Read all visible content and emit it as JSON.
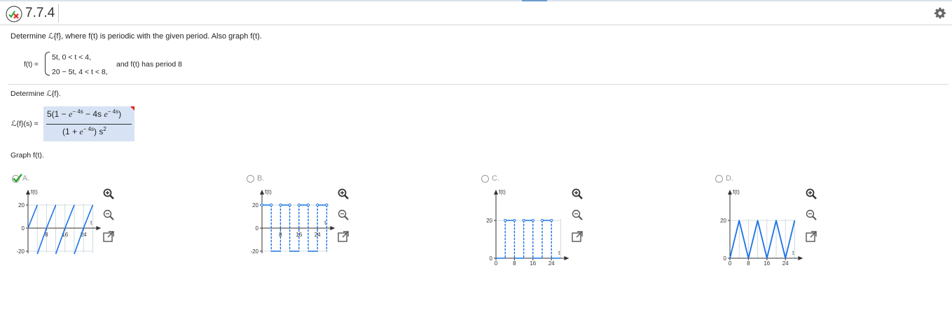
{
  "header": {
    "question_number": "7.7.4",
    "status_icon": "partial-credit-icon",
    "settings_icon": "gear-icon"
  },
  "problem": {
    "prompt": "Determine ℒ{f}, where f(t) is periodic with the given period. Also graph f(t).",
    "f_label": "f(t) =",
    "case1": "5t, 0 < t < 4,",
    "case2": "20 − 5t, 4 < t < 8,",
    "period_text": "and f(t) has period 8"
  },
  "part1": {
    "instruction": "Determine ℒ{f}.",
    "lhs": "ℒ{f}(s) =",
    "answer_numerator": {
      "a": "5(1 − ",
      "b": "e",
      "c": "− 4s",
      "d": " − 4s ",
      "e": "e",
      "f": "− 4s",
      "g": ")"
    },
    "answer_denominator": {
      "a": "(1 + ",
      "b": "e",
      "c": "− 4s",
      "d": ") s",
      "e": "2"
    },
    "answer_state": "incorrect-marked"
  },
  "part2": {
    "instruction": "Graph f(t).",
    "options": [
      {
        "letter": "A.",
        "selected": true,
        "y_ticks": [
          "20",
          "0",
          "-20"
        ],
        "x_ticks": [
          "8",
          "16",
          "24"
        ],
        "ylabel": "f(t)",
        "xlabel": "t"
      },
      {
        "letter": "B.",
        "selected": false,
        "y_ticks": [
          "20",
          "0",
          "-20"
        ],
        "x_ticks": [
          "8",
          "16",
          "24"
        ],
        "ylabel": "f(t)",
        "xlabel": "t"
      },
      {
        "letter": "C.",
        "selected": false,
        "y_ticks": [
          "20",
          "0"
        ],
        "x_ticks": [
          "0",
          "8",
          "16",
          "24"
        ],
        "ylabel": "f(t)",
        "xlabel": "t"
      },
      {
        "letter": "D.",
        "selected": false,
        "y_ticks": [
          "20",
          "0"
        ],
        "x_ticks": [
          "0",
          "8",
          "16",
          "24"
        ],
        "ylabel": "f(t)",
        "xlabel": "t"
      }
    ],
    "tools": [
      "zoom-in-icon",
      "zoom-out-icon",
      "popout-icon"
    ]
  },
  "colors": {
    "plot_line": "#1a73e8",
    "grid": "#c8d0d8",
    "answer_bg": "#d7e3f4",
    "incorrect_flag": "#e0201b",
    "check": "#2aa52a"
  }
}
